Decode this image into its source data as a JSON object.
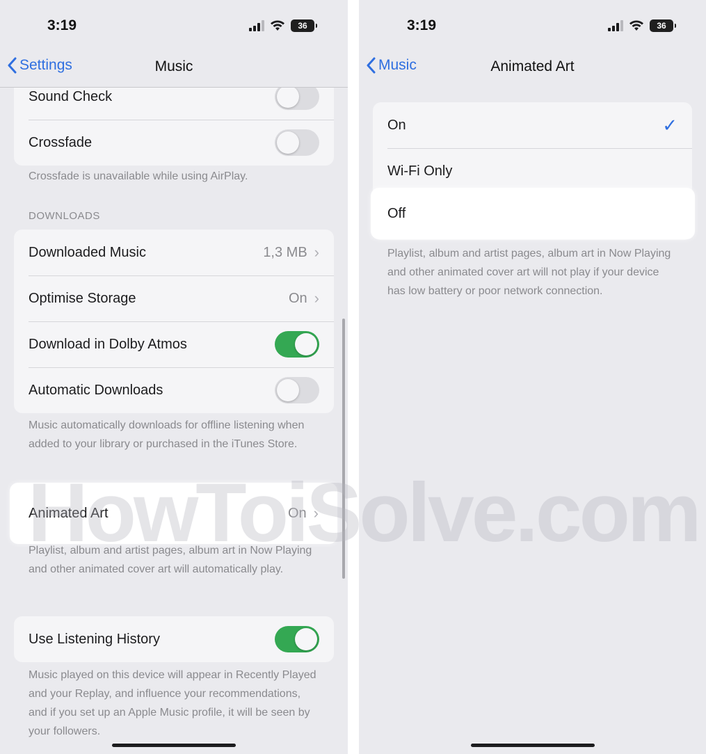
{
  "left": {
    "time": "3:19",
    "battery": "36",
    "back_label": "Settings",
    "title": "Music",
    "playback_group": [
      {
        "label": "Sound Check",
        "toggle": false
      },
      {
        "label": "Crossfade",
        "toggle": false
      }
    ],
    "crossfade_footer": "Crossfade is unavailable while using AirPlay.",
    "downloads_header": "DOWNLOADS",
    "downloads_group": {
      "downloaded_music": {
        "label": "Downloaded Music",
        "value": "1,3 MB"
      },
      "optimise_storage": {
        "label": "Optimise Storage",
        "value": "On"
      },
      "dolby_atmos": {
        "label": "Download in Dolby Atmos",
        "toggle": true
      },
      "automatic_downloads": {
        "label": "Automatic Downloads",
        "toggle": false
      }
    },
    "downloads_footer": "Music automatically downloads for offline listening when added to your library or purchased in the iTunes Store.",
    "animated_art": {
      "label": "Animated Art",
      "value": "On"
    },
    "animated_art_footer": "Playlist, album and artist pages, album art in Now Playing and other animated cover art will automatically play.",
    "listening_history": {
      "label": "Use Listening History",
      "toggle": true
    },
    "listening_history_footer": "Music played on this device will appear in Recently Played and your Replay, and influence your recommendations, and if you set up an Apple Music profile, it will be seen by your followers."
  },
  "right": {
    "time": "3:19",
    "battery": "36",
    "back_label": "Music",
    "title": "Animated Art",
    "options": [
      {
        "label": "On",
        "selected": true
      },
      {
        "label": "Wi-Fi Only",
        "selected": false
      },
      {
        "label": "Off",
        "selected": false
      }
    ],
    "footer": "Playlist, album and artist pages, album art in Now Playing and other animated cover art will not play if your device has low battery or poor network connection."
  },
  "watermark": "HowToiSolve.com",
  "colors": {
    "accent": "#2f6fe0",
    "toggle_on": "#34a853",
    "background": "#eaeaee"
  },
  "icons": [
    "signal-icon",
    "wifi-icon",
    "battery-icon",
    "chevron-left-icon",
    "chevron-right-icon",
    "checkmark-icon"
  ]
}
